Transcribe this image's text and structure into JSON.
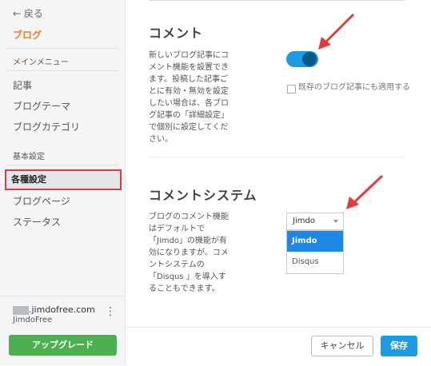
{
  "sidebar": {
    "back_label": "←  戻る",
    "blog_title": "ブログ",
    "main_menu_heading": "メインメニュー",
    "main_items": [
      "記事",
      "ブログテーマ",
      "ブログカテゴリ"
    ],
    "basic_heading": "基本設定",
    "basic_items": [
      "各種設定",
      "ブログページ",
      "ステータス"
    ],
    "active_item": "各種設定",
    "account": {
      "domain": ".jimdofree.com",
      "plan": "JimdoFree",
      "more": "⋮"
    },
    "upgrade_label": "アップグレード"
  },
  "comment_section": {
    "title": "コメント",
    "description": "新しいブログ記事にコメント機能を設置できます。投稿した記事ごとに有効・無効を設定したい場合は、各ブログ記事の「詳細設定」で個別に設定してください。",
    "toggle_on": true,
    "checkbox_label": "既存のブログ記事にも適用する",
    "checkbox_checked": false
  },
  "comment_system_section": {
    "title": "コメントシステム",
    "description": "ブログのコメント機能はデフォルトで「Jimdo」の機能が有効になりますが、コメントシステムの「Disqus 」を導入することもできます。",
    "select_value": "Jimdo",
    "options": [
      "Jimdo",
      "Disqus"
    ],
    "highlighted_option": "Jimdo"
  },
  "footer": {
    "cancel_label": "キャンセル",
    "save_label": "保存"
  },
  "colors": {
    "accent_orange": "#f47b20",
    "primary_blue": "#1e9be0",
    "upgrade_green": "#4caf50",
    "annotation_red": "#e23b3b"
  }
}
